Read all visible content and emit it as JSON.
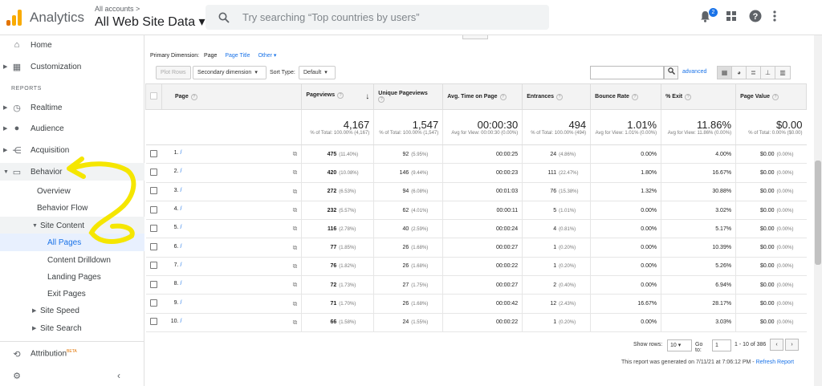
{
  "header": {
    "app_name": "Analytics",
    "account_small": "All accounts >",
    "account_view": "All Web Site Data ▾",
    "search_placeholder": "Try searching “Top countries by users”",
    "notification_count": "2"
  },
  "sidebar": {
    "home": "Home",
    "customization": "Customization",
    "reports_label": "REPORTS",
    "realtime": "Realtime",
    "audience": "Audience",
    "acquisition": "Acquisition",
    "behavior": "Behavior",
    "overview": "Overview",
    "behavior_flow": "Behavior Flow",
    "site_content": "Site Content",
    "all_pages": "All Pages",
    "content_drilldown": "Content Drilldown",
    "landing_pages": "Landing Pages",
    "exit_pages": "Exit Pages",
    "site_speed": "Site Speed",
    "site_search": "Site Search",
    "attribution": "Attribution",
    "beta": "BETA"
  },
  "controls": {
    "primary_dimension_label": "Primary Dimension:",
    "dim_page": "Page",
    "dim_page_title": "Page Title",
    "dim_other": "Other ▾",
    "plot_rows": "Plot Rows",
    "secondary_dimension": "Secondary dimension",
    "sort_type_label": "Sort Type:",
    "sort_type_value": "Default",
    "advanced": "advanced"
  },
  "table": {
    "headers": {
      "page": "Page",
      "pageviews": "Pageviews",
      "unique_pageviews": "Unique Pageviews",
      "avg_time": "Avg. Time on Page",
      "entrances": "Entrances",
      "bounce_rate": "Bounce Rate",
      "exit": "% Exit",
      "page_value": "Page Value"
    },
    "totals": {
      "pageviews": "4,167",
      "pageviews_sub": "% of Total: 100.00% (4,167)",
      "unique": "1,547",
      "unique_sub": "% of Total: 100.00% (1,547)",
      "avg_time": "00:00:30",
      "avg_time_sub": "Avg for View: 00:00:30 (0.00%)",
      "entrances": "494",
      "entrances_sub": "% of Total: 100.00% (494)",
      "bounce": "1.01%",
      "bounce_sub": "Avg for View: 1.01% (0.00%)",
      "exit": "11.86%",
      "exit_sub": "Avg for View: 11.86% (0.00%)",
      "value": "$0.00",
      "value_sub": "% of Total: 0.00% ($0.00)"
    },
    "rows": [
      {
        "idx": "1.",
        "page": "/",
        "pv": "475",
        "pv_pct": "(11.40%)",
        "upv": "92",
        "upv_pct": "(5.95%)",
        "time": "00:00:25",
        "ent": "24",
        "ent_pct": "(4.86%)",
        "bounce": "0.00%",
        "exit": "4.00%",
        "val": "$0.00",
        "val_pct": "(0.00%)"
      },
      {
        "idx": "2.",
        "page": "/",
        "pv": "420",
        "pv_pct": "(10.08%)",
        "upv": "146",
        "upv_pct": "(9.44%)",
        "time": "00:00:23",
        "ent": "111",
        "ent_pct": "(22.47%)",
        "bounce": "1.80%",
        "exit": "16.67%",
        "val": "$0.00",
        "val_pct": "(0.00%)"
      },
      {
        "idx": "3.",
        "page": "/",
        "pv": "272",
        "pv_pct": "(6.53%)",
        "upv": "94",
        "upv_pct": "(6.08%)",
        "time": "00:01:03",
        "ent": "76",
        "ent_pct": "(15.38%)",
        "bounce": "1.32%",
        "exit": "30.88%",
        "val": "$0.00",
        "val_pct": "(0.00%)"
      },
      {
        "idx": "4.",
        "page": "/",
        "pv": "232",
        "pv_pct": "(5.57%)",
        "upv": "62",
        "upv_pct": "(4.01%)",
        "time": "00:00:11",
        "ent": "5",
        "ent_pct": "(1.01%)",
        "bounce": "0.00%",
        "exit": "3.02%",
        "val": "$0.00",
        "val_pct": "(0.00%)"
      },
      {
        "idx": "5.",
        "page": "/",
        "pv": "116",
        "pv_pct": "(2.78%)",
        "upv": "40",
        "upv_pct": "(2.59%)",
        "time": "00:00:24",
        "ent": "4",
        "ent_pct": "(0.81%)",
        "bounce": "0.00%",
        "exit": "5.17%",
        "val": "$0.00",
        "val_pct": "(0.00%)"
      },
      {
        "idx": "6.",
        "page": "/",
        "pv": "77",
        "pv_pct": "(1.85%)",
        "upv": "26",
        "upv_pct": "(1.68%)",
        "time": "00:00:27",
        "ent": "1",
        "ent_pct": "(0.20%)",
        "bounce": "0.00%",
        "exit": "10.39%",
        "val": "$0.00",
        "val_pct": "(0.00%)"
      },
      {
        "idx": "7.",
        "page": "/",
        "pv": "76",
        "pv_pct": "(1.82%)",
        "upv": "26",
        "upv_pct": "(1.68%)",
        "time": "00:00:22",
        "ent": "1",
        "ent_pct": "(0.20%)",
        "bounce": "0.00%",
        "exit": "5.26%",
        "val": "$0.00",
        "val_pct": "(0.00%)"
      },
      {
        "idx": "8.",
        "page": "/",
        "pv": "72",
        "pv_pct": "(1.73%)",
        "upv": "27",
        "upv_pct": "(1.75%)",
        "time": "00:00:27",
        "ent": "2",
        "ent_pct": "(0.40%)",
        "bounce": "0.00%",
        "exit": "6.94%",
        "val": "$0.00",
        "val_pct": "(0.00%)"
      },
      {
        "idx": "9.",
        "page": "/",
        "pv": "71",
        "pv_pct": "(1.70%)",
        "upv": "26",
        "upv_pct": "(1.68%)",
        "time": "00:00:42",
        "ent": "12",
        "ent_pct": "(2.43%)",
        "bounce": "16.67%",
        "exit": "28.17%",
        "val": "$0.00",
        "val_pct": "(0.00%)"
      },
      {
        "idx": "10.",
        "page": "/",
        "pv": "66",
        "pv_pct": "(1.58%)",
        "upv": "24",
        "upv_pct": "(1.55%)",
        "time": "00:00:22",
        "ent": "1",
        "ent_pct": "(0.20%)",
        "bounce": "0.00%",
        "exit": "3.03%",
        "val": "$0.00",
        "val_pct": "(0.00%)"
      }
    ]
  },
  "footer": {
    "show_rows_label": "Show rows:",
    "show_rows_value": "10",
    "goto_label": "Go to:",
    "goto_value": "1",
    "range": "1 - 10 of 386",
    "generated": "This report was generated on 7/11/21 at 7:06:12 PM -",
    "refresh": "Refresh Report"
  },
  "icons": {
    "prev": "‹",
    "next": "›"
  }
}
